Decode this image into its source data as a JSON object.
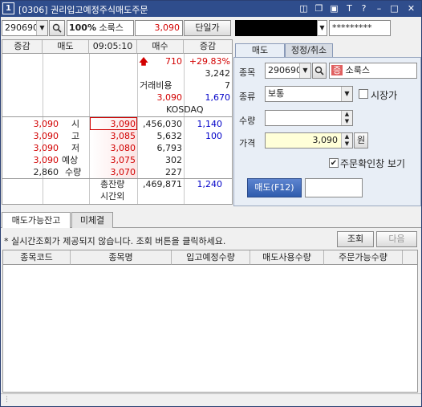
{
  "window": {
    "number": "1",
    "title": "[0306] 권리입고예정주식매도주문"
  },
  "toolbar": {
    "code": "290690",
    "pct": "100%",
    "name": "소룩스",
    "price": "3,090",
    "single_button": "단일가",
    "password": "*********"
  },
  "orderbook": {
    "headers": {
      "change": "증감",
      "sell": "매도",
      "time": "09:05:10",
      "buy": "매수",
      "change2": "증감"
    },
    "summary": [
      {
        "left": "710",
        "right": "+29.83%"
      },
      {
        "left": "",
        "right": "3,242"
      },
      {
        "left": "거래비용",
        "right": "7"
      },
      {
        "left": "3,090",
        "right": "1,670"
      },
      {
        "left": "KOSDAQ",
        "right": ""
      }
    ],
    "left_rows": [
      {
        "price": "3,090",
        "label": "시"
      },
      {
        "price": "3,090",
        "label": "고"
      },
      {
        "price": "3,090",
        "label": "저"
      },
      {
        "price": "3,090",
        "label": "예상"
      },
      {
        "price": "2,860",
        "label": "수량"
      }
    ],
    "bid_rows": [
      {
        "price": "3,090",
        "qty": ",456,030",
        "chg": "1,140"
      },
      {
        "price": "3,085",
        "qty": "5,632",
        "chg": "100"
      },
      {
        "price": "3,080",
        "qty": "6,793",
        "chg": ""
      },
      {
        "price": "3,075",
        "qty": "302",
        "chg": ""
      },
      {
        "price": "3,070",
        "qty": "227",
        "chg": ""
      }
    ],
    "total_label": "총잔량",
    "total_qty": ",469,871",
    "total_chg": "1,240",
    "after_label": "시간외"
  },
  "order_panel": {
    "tab_sell": "매도",
    "tab_modify": "정정/취소",
    "label_code": "종목",
    "code": "290690",
    "badge": "증",
    "name": "소룩스",
    "label_type": "종류",
    "type_value": "보통",
    "market_label": "시장가",
    "label_qty": "수량",
    "qty_value": "",
    "label_price": "가격",
    "price_value": "3,090",
    "unit": "원",
    "confirm_label": "주문확인창 보기",
    "submit": "매도(F12)"
  },
  "bottom": {
    "tab1": "매도가능잔고",
    "tab2": "미체결",
    "notice": "* 실시간조회가 제공되지 않습니다. 조회 버튼을 클릭하세요.",
    "query_button": "조회",
    "next_button": "다음",
    "columns": [
      "종목코드",
      "종목명",
      "입고예정수량",
      "매도사용수량",
      "주문가능수량"
    ]
  },
  "colors": {
    "title_bar": "#2f4d8c",
    "up": "#d20000",
    "down": "#0000c8"
  }
}
